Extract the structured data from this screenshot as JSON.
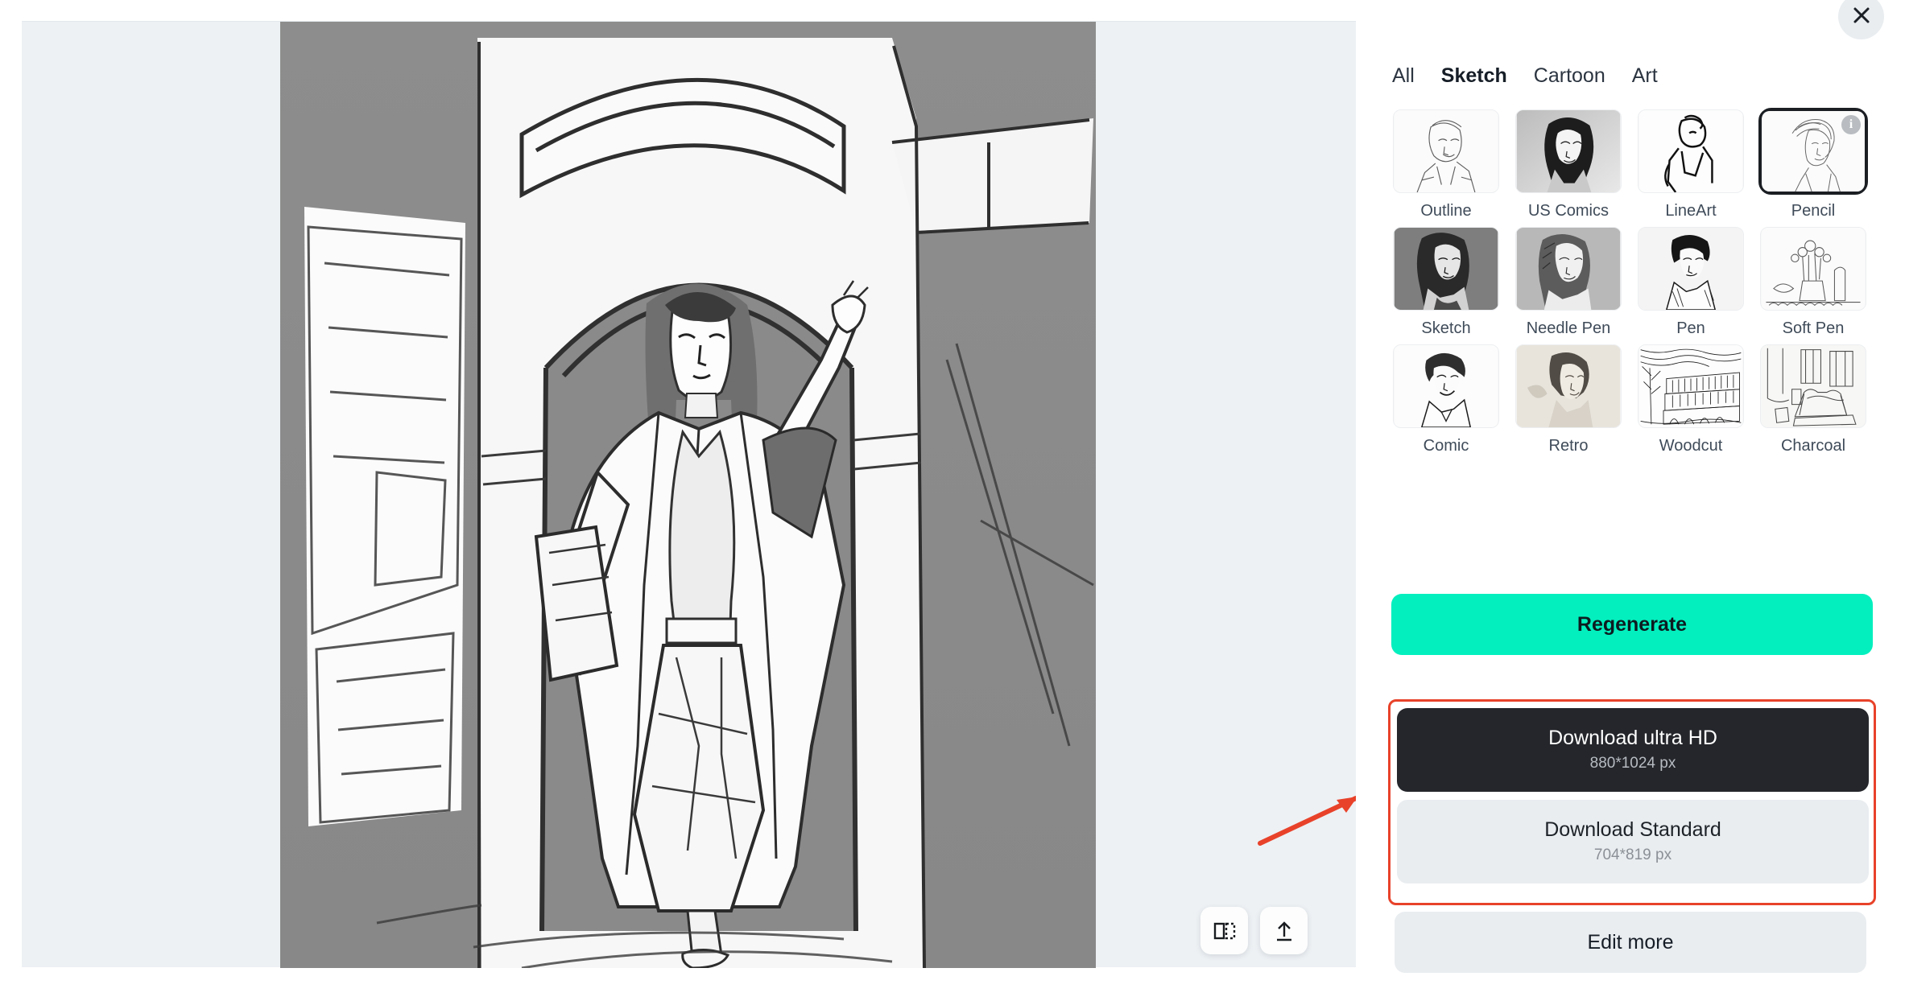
{
  "canvas": {
    "tools": [
      {
        "name": "compare-icon",
        "label": "Compare"
      },
      {
        "name": "upload-icon",
        "label": "Upload"
      }
    ]
  },
  "side_panel": {
    "close_label": "×",
    "tabs": [
      {
        "label": "All",
        "active": false
      },
      {
        "label": "Sketch",
        "active": true
      },
      {
        "label": "Cartoon",
        "active": false
      },
      {
        "label": "Art",
        "active": false
      }
    ],
    "styles": [
      {
        "label": "Outline",
        "selected": false,
        "info": false
      },
      {
        "label": "US Comics",
        "selected": false,
        "info": false
      },
      {
        "label": "LineArt",
        "selected": false,
        "info": false
      },
      {
        "label": "Pencil",
        "selected": true,
        "info": true,
        "info_label": "i"
      },
      {
        "label": "Sketch",
        "selected": false,
        "info": false
      },
      {
        "label": "Needle Pen",
        "selected": false,
        "info": false
      },
      {
        "label": "Pen",
        "selected": false,
        "info": false
      },
      {
        "label": "Soft Pen",
        "selected": false,
        "info": false
      },
      {
        "label": "Comic",
        "selected": false,
        "info": false
      },
      {
        "label": "Retro",
        "selected": false,
        "info": false
      },
      {
        "label": "Woodcut",
        "selected": false,
        "info": false
      },
      {
        "label": "Charcoal",
        "selected": false,
        "info": false
      }
    ],
    "regenerate_label": "Regenerate",
    "download_ultra": {
      "title": "Download ultra HD",
      "subtitle": "880*1024 px"
    },
    "download_standard": {
      "title": "Download Standard",
      "subtitle": "704*819 px"
    },
    "edit_more_label": "Edit more"
  },
  "colors": {
    "accent_green": "#03efbe",
    "annotation_red": "#e8422a",
    "dark_button": "#24262b",
    "panel_bg": "#edf1f4",
    "light_button": "#e9edf0"
  }
}
